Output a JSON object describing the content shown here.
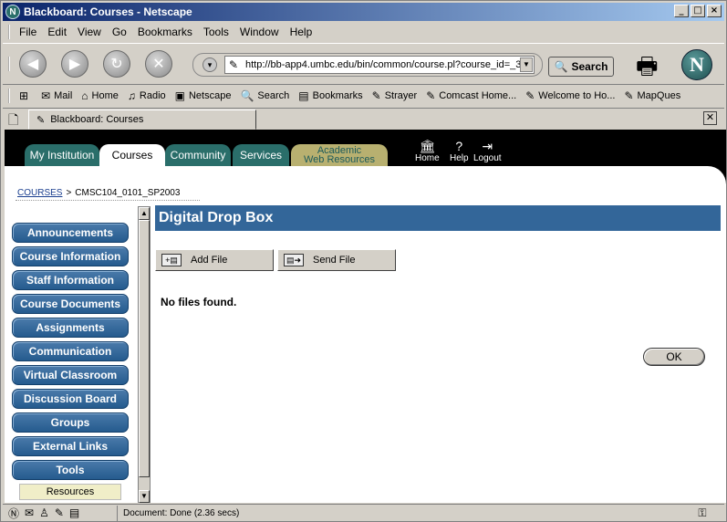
{
  "window": {
    "title": "Blackboard: Courses - Netscape",
    "min": "_",
    "max": "□",
    "close": "×"
  },
  "menu": [
    "File",
    "Edit",
    "View",
    "Go",
    "Bookmarks",
    "Tools",
    "Window",
    "Help"
  ],
  "nav": {
    "url": "http://bb-app4.umbc.edu/bin/common/course.pl?course_id=_3(",
    "search_label": "Search"
  },
  "personal_toolbar": [
    "Mail",
    "Home",
    "Radio",
    "Netscape",
    "Search",
    "Bookmarks",
    "Strayer",
    "Comcast Home...",
    "Welcome to Ho...",
    "MapQues"
  ],
  "tab": {
    "label": "Blackboard: Courses"
  },
  "bb_tabs": {
    "my_institution": "My Institution",
    "courses": "Courses",
    "community": "Community",
    "services": "Services",
    "academic_line1": "Academic",
    "academic_line2": "Web Resources"
  },
  "header_icons": {
    "home": "Home",
    "help": "Help",
    "logout": "Logout"
  },
  "breadcrumb": {
    "root": "COURSES",
    "sep": ">",
    "current": "CMSC104_0101_SP2003"
  },
  "left_menu": [
    "Announcements",
    "Course Information",
    "Staff Information",
    "Course Documents",
    "Assignments",
    "Communication",
    "Virtual Classroom",
    "Discussion Board",
    "Groups",
    "External Links",
    "Tools"
  ],
  "resources_label": "Resources",
  "main": {
    "title": "Digital Drop Box",
    "add_file": "Add File",
    "send_file": "Send File",
    "empty_msg": "No files found.",
    "ok": "OK"
  },
  "status": {
    "text": "Document: Done (2.36 secs)"
  },
  "colors": {
    "header_blue": "#336699",
    "menu_blue": "#255b8e",
    "tab_teal": "#2a6e6a",
    "academic_tab": "#b8b070"
  }
}
